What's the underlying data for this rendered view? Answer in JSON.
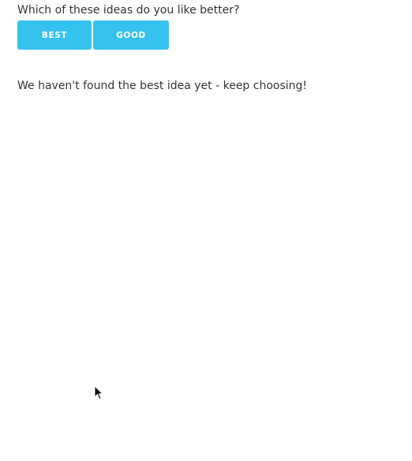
{
  "question": "Which of these ideas do you like better?",
  "choices": {
    "first_label": "BEST",
    "second_label": "GOOD"
  },
  "status": "We haven't found the best idea yet - keep choosing!",
  "accent_color": "#36c2ef",
  "icons": {
    "cursor": "mouse-pointer-icon"
  }
}
